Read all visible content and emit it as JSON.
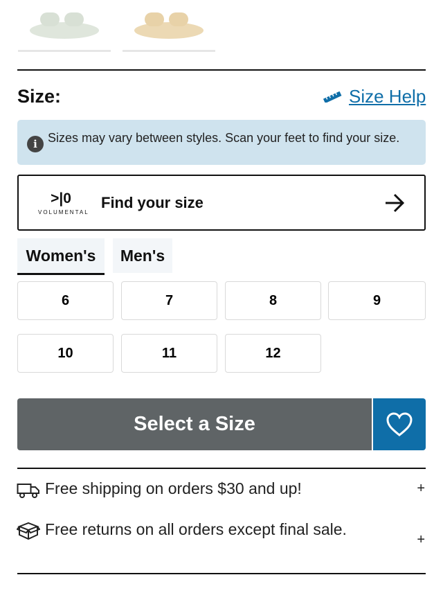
{
  "colors": {
    "banner_bg": "#cfe3ee",
    "cta_bg": "#5f6466",
    "wish_bg": "#0f6ea8",
    "link": "#0f6ea8"
  },
  "swatches": [
    {
      "name": "light-green-sandal",
      "color": "#dfe6dc"
    },
    {
      "name": "tan-sandal",
      "color": "#ecd9b4"
    }
  ],
  "size_section": {
    "label": "Size:",
    "help_link": "Size Help",
    "info_text": "Sizes may vary between styles. Scan your feet to find your size.",
    "find_size": {
      "logo_mark": ">|0",
      "logo_name": "VOLUMENTAL",
      "label": "Find your size"
    },
    "tabs": [
      {
        "label": "Women's",
        "selected": true
      },
      {
        "label": "Men's",
        "selected": false
      }
    ],
    "sizes": [
      "6",
      "7",
      "8",
      "9",
      "10",
      "11",
      "12"
    ]
  },
  "cta": {
    "label": "Select a Size"
  },
  "perks": [
    {
      "icon": "truck-icon",
      "text": "Free shipping on orders $30 and up!"
    },
    {
      "icon": "gift-box-icon",
      "text": "Free returns on all orders except final sale."
    }
  ]
}
